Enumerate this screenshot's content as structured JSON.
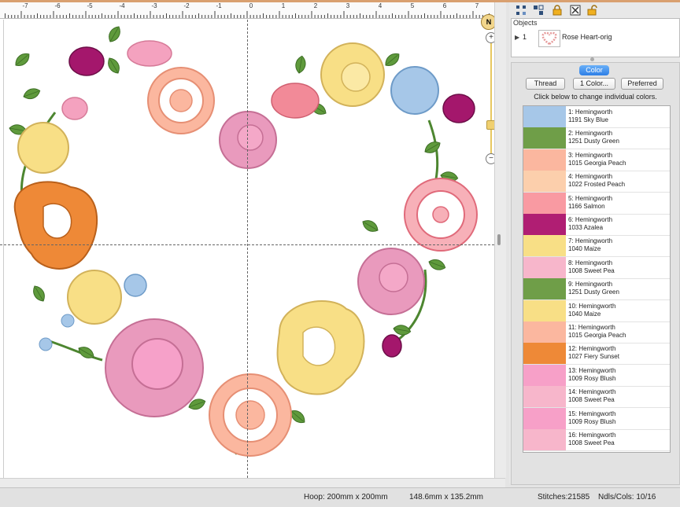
{
  "ruler": {
    "ticks": [
      "-7",
      "-6",
      "-5",
      "-4",
      "-3",
      "-2",
      "-1",
      "0",
      "1",
      "2",
      "3",
      "4",
      "5",
      "6",
      "7"
    ]
  },
  "compass": "N",
  "zoom": {
    "plus": "+",
    "minus": "−"
  },
  "objects": {
    "title": "Objects",
    "items": [
      {
        "index": "1",
        "name": "Rose Heart-orig"
      }
    ]
  },
  "color_panel": {
    "tab_label": "Color",
    "thread_button": "Thread",
    "one_color_button": "1 Color...",
    "preferred_button": "Preferred",
    "hint": "Click below to change individual colors.",
    "colors": [
      {
        "line1": "1: Hemingworth",
        "line2": "1191 Sky Blue",
        "hex": "#a6c7e8"
      },
      {
        "line1": "2: Hemingworth",
        "line2": "1251 Dusty Green",
        "hex": "#6f9e48"
      },
      {
        "line1": "3: Hemingworth",
        "line2": "1015 Georgia Peach",
        "hex": "#fbb79f"
      },
      {
        "line1": "4: Hemingworth",
        "line2": "1022 Frosted Peach",
        "hex": "#fccfac"
      },
      {
        "line1": "5: Hemingworth",
        "line2": "1166 Salmon",
        "hex": "#f99aa2"
      },
      {
        "line1": "6: Hemingworth",
        "line2": "1033 Azalea",
        "hex": "#b01e73"
      },
      {
        "line1": "7: Hemingworth",
        "line2": "1040 Maize",
        "hex": "#f8df86"
      },
      {
        "line1": "8: Hemingworth",
        "line2": "1008 Sweet Pea",
        "hex": "#f7b6cb"
      },
      {
        "line1": "9: Hemingworth",
        "line2": "1251 Dusty Green",
        "hex": "#6f9e48"
      },
      {
        "line1": "10: Hemingworth",
        "line2": "1040 Maize",
        "hex": "#f8df86"
      },
      {
        "line1": "11: Hemingworth",
        "line2": "1015 Georgia Peach",
        "hex": "#fbb79f"
      },
      {
        "line1": "12: Hemingworth",
        "line2": "1027 Fiery Sunset",
        "hex": "#ee8937"
      },
      {
        "line1": "13: Hemingworth",
        "line2": "1009 Rosy Blush",
        "hex": "#f7a0c8"
      },
      {
        "line1": "14: Hemingworth",
        "line2": "1008 Sweet Pea",
        "hex": "#f7b6cb"
      },
      {
        "line1": "15: Hemingworth",
        "line2": "1009 Rosy Blush",
        "hex": "#f7a0c8"
      },
      {
        "line1": "16: Hemingworth",
        "line2": "1008 Sweet Pea",
        "hex": "#f7b6cb"
      }
    ]
  },
  "status": {
    "hoop": "Hoop: 200mm x 200mm",
    "size": "148.6mm x 135.2mm",
    "stitches": "Stitches:21585",
    "ndls": "Ndls/Cols: 10/16"
  },
  "icons": [
    "select-icon",
    "group-icon",
    "lock-icon",
    "delete-icon",
    "unlock-icon",
    "rose-heart-thumbnail-icon"
  ]
}
